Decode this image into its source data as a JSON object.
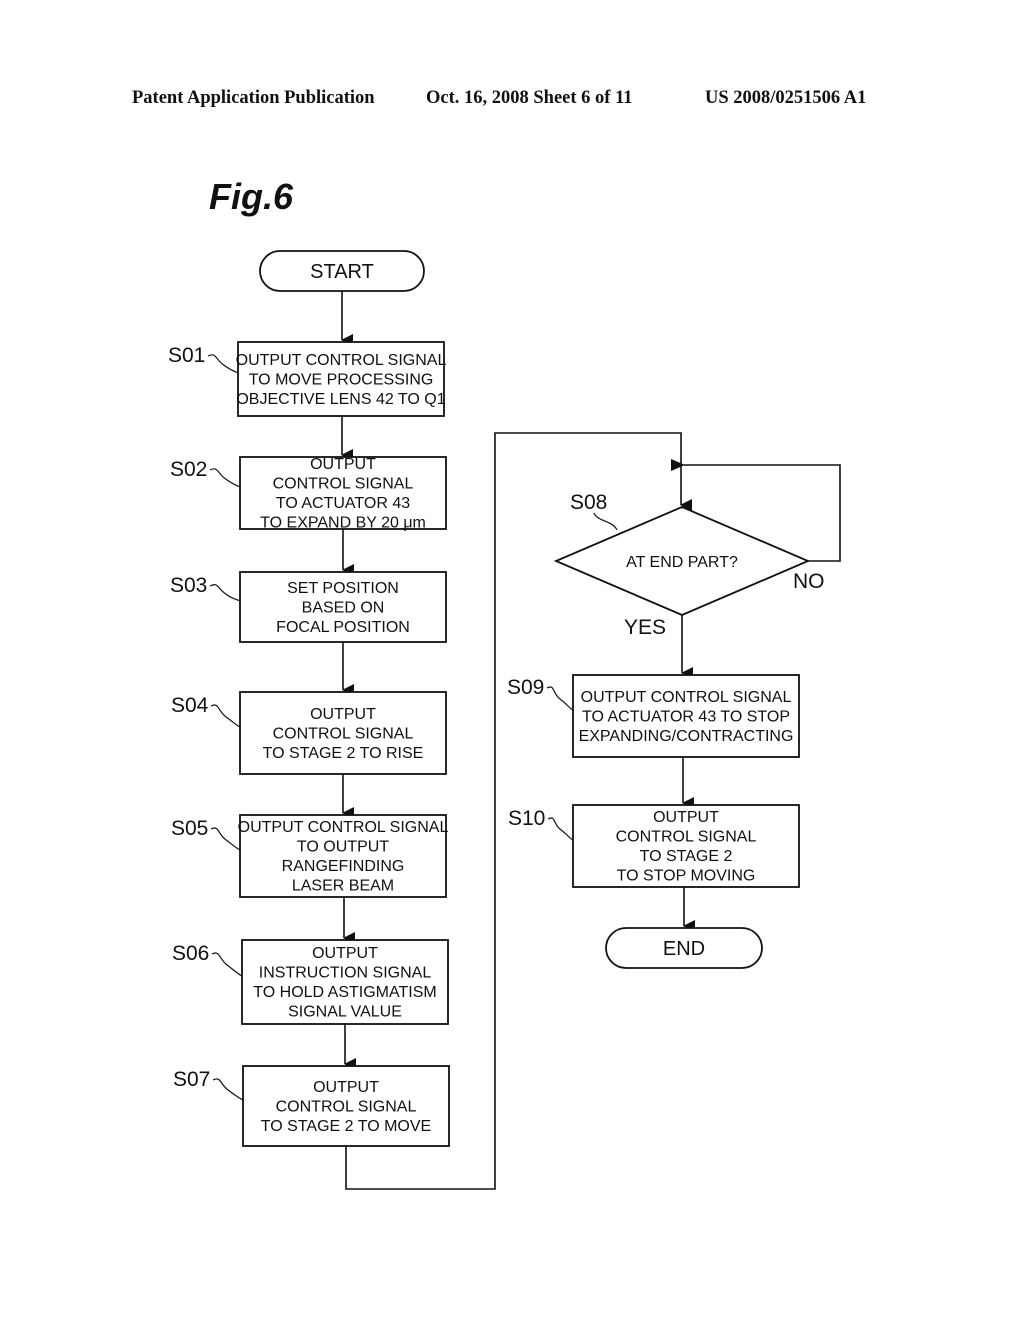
{
  "header": {
    "publication": "Patent Application Publication",
    "date_sheet": "Oct. 16, 2008   Sheet 6 of 11",
    "patent_number": "US 2008/0251506 A1"
  },
  "figure": {
    "title": "Fig.6"
  },
  "flowchart": {
    "start": "START",
    "end": "END",
    "steps": [
      {
        "id": "S01",
        "lines": [
          "OUTPUT CONTROL SIGNAL",
          "TO MOVE PROCESSING",
          "OBJECTIVE LENS 42 TO Q1"
        ]
      },
      {
        "id": "S02",
        "lines": [
          "OUTPUT",
          "CONTROL SIGNAL",
          "TO ACTUATOR 43",
          "TO EXPAND BY 20 μm"
        ]
      },
      {
        "id": "S03",
        "lines": [
          "SET POSITION",
          "BASED ON",
          "FOCAL POSITION"
        ]
      },
      {
        "id": "S04",
        "lines": [
          "OUTPUT",
          "CONTROL SIGNAL",
          "TO STAGE 2 TO RISE"
        ]
      },
      {
        "id": "S05",
        "lines": [
          "OUTPUT CONTROL SIGNAL",
          "TO OUTPUT",
          "RANGEFINDING",
          "LASER BEAM"
        ]
      },
      {
        "id": "S06",
        "lines": [
          "OUTPUT",
          "INSTRUCTION SIGNAL",
          "TO HOLD ASTIGMATISM",
          "SIGNAL VALUE"
        ]
      },
      {
        "id": "S07",
        "lines": [
          "OUTPUT",
          "CONTROL SIGNAL",
          "TO STAGE 2 TO MOVE"
        ]
      },
      {
        "id": "S09",
        "lines": [
          "OUTPUT CONTROL SIGNAL",
          "TO ACTUATOR 43 TO STOP",
          "EXPANDING/CONTRACTING"
        ]
      },
      {
        "id": "S10",
        "lines": [
          "OUTPUT",
          "CONTROL SIGNAL",
          "TO STAGE 2",
          "TO STOP MOVING"
        ]
      }
    ],
    "decision": {
      "id": "S08",
      "text": "AT END PART?",
      "yes_label": "YES",
      "no_label": "NO"
    }
  }
}
